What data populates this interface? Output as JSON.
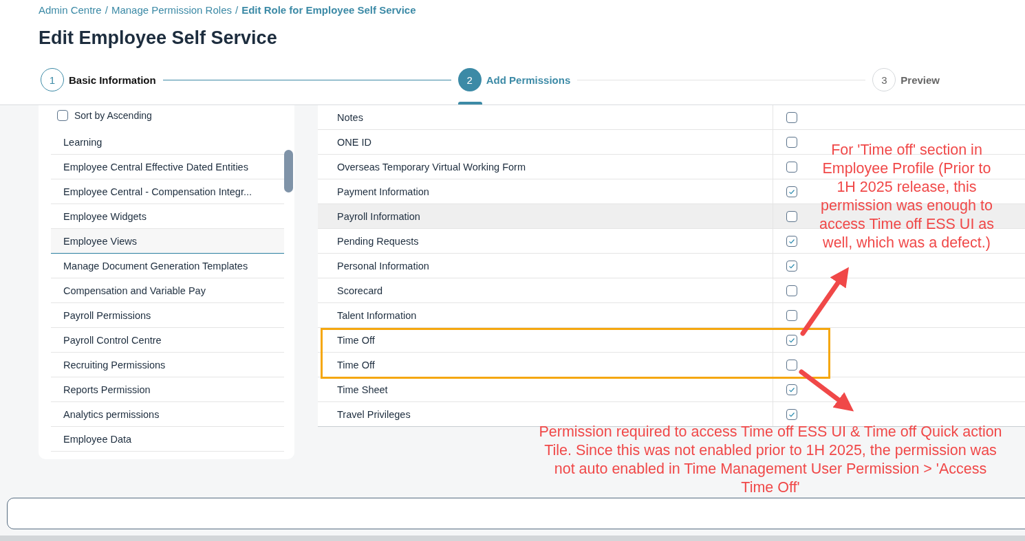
{
  "breadcrumb": [
    {
      "label": "Admin Centre",
      "current": false
    },
    {
      "label": "Manage Permission Roles",
      "current": false
    },
    {
      "label": "Edit Role for Employee Self Service",
      "current": true
    }
  ],
  "breadcrumb_separator": "/",
  "title": "Edit Employee Self Service",
  "steps": [
    {
      "number": "1",
      "label": "Basic Information",
      "completed": true,
      "selected": false
    },
    {
      "number": "2",
      "label": "Add Permissions",
      "completed": false,
      "selected": true
    },
    {
      "number": "3",
      "label": "Preview",
      "completed": false,
      "selected": false
    }
  ],
  "sort": {
    "label": "Sort by Ascending",
    "checked": false
  },
  "categories": [
    {
      "label": "Learning",
      "selected": false
    },
    {
      "label": "Employee Central Effective Dated Entities",
      "selected": false
    },
    {
      "label": "Employee Central - Compensation Integr...",
      "selected": false
    },
    {
      "label": "Employee Widgets",
      "selected": false
    },
    {
      "label": "Employee Views",
      "selected": true
    },
    {
      "label": "Manage Document Generation Templates",
      "selected": false
    },
    {
      "label": "Compensation and Variable Pay",
      "selected": false
    },
    {
      "label": "Payroll Permissions",
      "selected": false
    },
    {
      "label": "Payroll Control Centre",
      "selected": false
    },
    {
      "label": "Recruiting Permissions",
      "selected": false
    },
    {
      "label": "Reports Permission",
      "selected": false
    },
    {
      "label": "Analytics permissions",
      "selected": false
    },
    {
      "label": "Employee Data",
      "selected": false
    }
  ],
  "permissions": [
    {
      "name": "Notes",
      "checked": false,
      "hovered": false
    },
    {
      "name": "ONE ID",
      "checked": false,
      "hovered": false
    },
    {
      "name": "Overseas Temporary Virtual Working Form",
      "checked": false,
      "hovered": false
    },
    {
      "name": "Payment Information",
      "checked": true,
      "hovered": false
    },
    {
      "name": "Payroll Information",
      "checked": false,
      "hovered": true
    },
    {
      "name": "Pending Requests",
      "checked": true,
      "hovered": false
    },
    {
      "name": "Personal Information",
      "checked": true,
      "hovered": false
    },
    {
      "name": "Scorecard",
      "checked": false,
      "hovered": false
    },
    {
      "name": "Talent Information",
      "checked": false,
      "hovered": false
    },
    {
      "name": "Time Off",
      "checked": true,
      "hovered": false
    },
    {
      "name": "Time Off",
      "checked": false,
      "hovered": false
    },
    {
      "name": "Time Sheet",
      "checked": true,
      "hovered": false
    },
    {
      "name": "Travel Privileges",
      "checked": true,
      "hovered": false
    }
  ],
  "annotations": [
    "For 'Time off' section in Employee Profile (Prior to 1H 2025 release, this permission was enough to access Time off ESS UI as well, which was a defect.)",
    "Permission required to access Time off ESS UI & Time off Quick action Tile. Since this was not enabled prior to 1H 2025, the permission was not auto enabled in Time Management User Permission > 'Access Time Off'"
  ]
}
